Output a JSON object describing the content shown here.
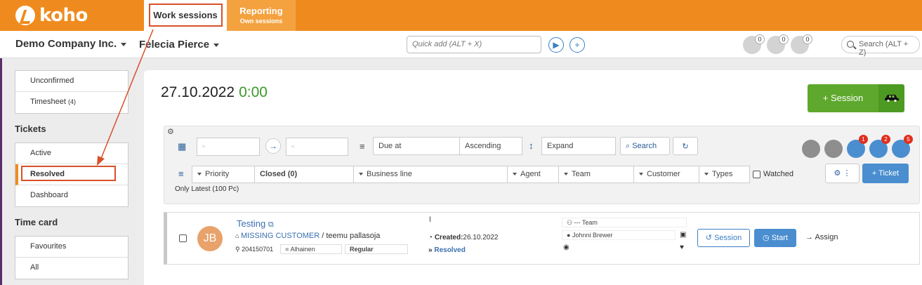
{
  "brand": {
    "name": "koho"
  },
  "tabs": [
    {
      "label": "Work sessions",
      "sub": ""
    },
    {
      "label": "Reporting",
      "sub": "Own sessions"
    }
  ],
  "header": {
    "company": "Demo Company Inc.",
    "person": "Felecia Pierce",
    "quickadd_placeholder": "Quick add (ALT + X)",
    "search_placeholder": "Search (ALT + Z)",
    "counts": [
      "0",
      "0",
      "0"
    ]
  },
  "sidebar": {
    "group1": [
      "Unconfirmed",
      "Timesheet"
    ],
    "timesheet_count": "(4)",
    "tickets_title": "Tickets",
    "tickets": [
      "Active",
      "Resolved",
      "Dashboard"
    ],
    "timecard_title": "Time card",
    "timecard": [
      "Favourites",
      "All"
    ]
  },
  "main": {
    "date": "27.10.2022",
    "time": "0:00",
    "session_button": "+ Session"
  },
  "filters": {
    "sort_field": "Due at",
    "sort_order": "Ascending",
    "expand": "Expand",
    "search_button": "Search",
    "priority": "Priority",
    "closed": "Closed (0)",
    "business_line": "Business line",
    "agent": "Agent",
    "team": "Team",
    "customer": "Customer",
    "types": "Types",
    "watched": "Watched",
    "only_latest": "Only Latest (100 Pc)",
    "ticket_button": "+ Ticket",
    "badges": [
      "1",
      "2",
      "5"
    ]
  },
  "ticket": {
    "initials": "JB",
    "title": "Testing",
    "customer": "MISSING CUSTOMER",
    "contact": "/ teemu pallasoja",
    "number": "204150701",
    "level": "Alhainen",
    "type": "Regular",
    "created_label": "Created:",
    "created_date": "26.10.2022",
    "status": "Resolved",
    "team": "--- Team",
    "agent": "Johnni Brewer",
    "session_button": "Session",
    "start_button": "Start",
    "assign": "Assign"
  },
  "colors": {
    "brand_orange": "#ef8b1e",
    "session_green": "#5ea82d",
    "primary_blue": "#4a8ed0",
    "annotation_red": "#d8502a"
  }
}
